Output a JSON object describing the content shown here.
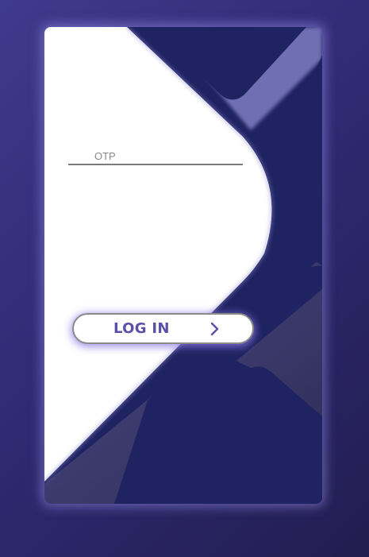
{
  "form": {
    "otp_placeholder": "OTP",
    "otp_value": ""
  },
  "login_button": {
    "label": "LOG IN",
    "icon": "chevron-right-icon"
  },
  "colors": {
    "background": "#3f3a8c",
    "navy_panel": "#1f2361",
    "accent_text": "#5b4fa8"
  }
}
